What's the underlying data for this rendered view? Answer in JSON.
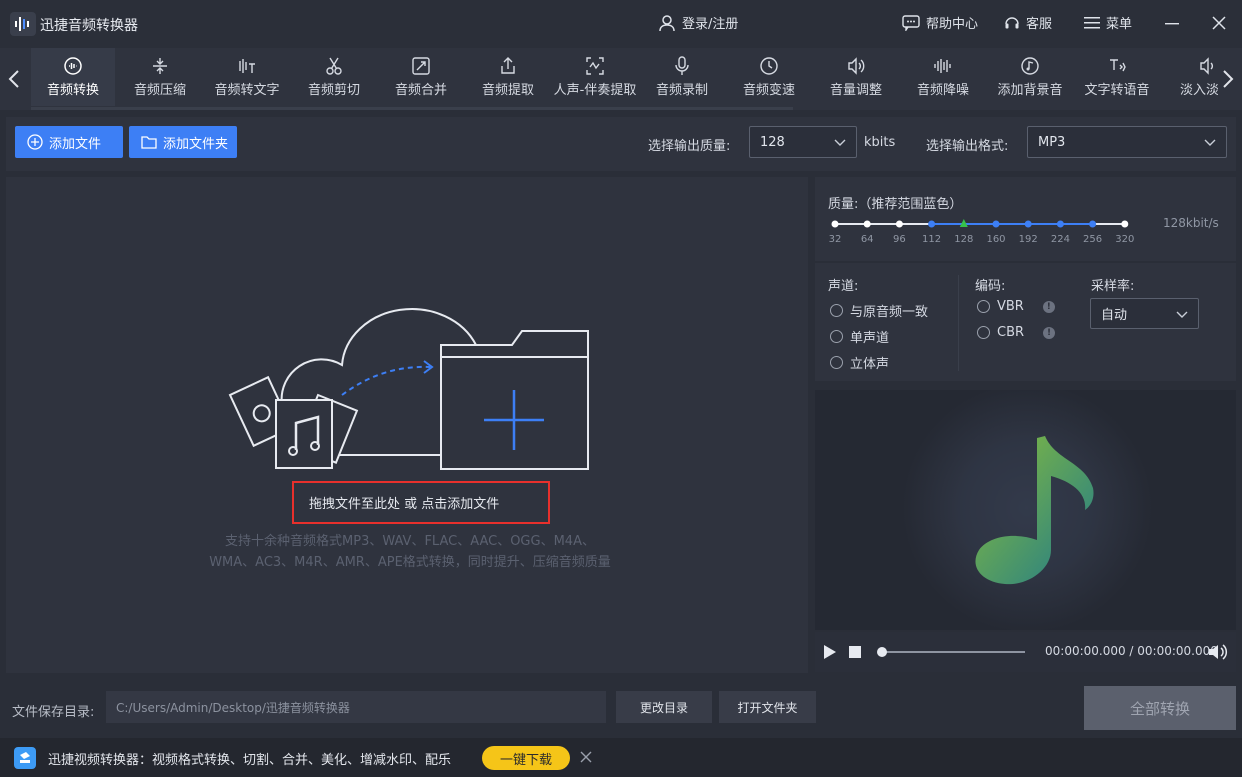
{
  "app": {
    "title": "迅捷音频转换器"
  },
  "header": {
    "login": "登录/注册",
    "help": "帮助中心",
    "service": "客服",
    "menu": "菜单"
  },
  "toolbar": {
    "tools": [
      {
        "label": "音频转换",
        "icon": "audio-convert-icon",
        "active": true
      },
      {
        "label": "音频压缩",
        "icon": "compress-icon"
      },
      {
        "label": "音频转文字",
        "icon": "audio-to-text-icon"
      },
      {
        "label": "音频剪切",
        "icon": "scissors-icon"
      },
      {
        "label": "音频合并",
        "icon": "merge-icon"
      },
      {
        "label": "音频提取",
        "icon": "extract-icon"
      },
      {
        "label": "人声-伴奏提取",
        "icon": "vocal-separate-icon"
      },
      {
        "label": "音频录制",
        "icon": "microphone-icon"
      },
      {
        "label": "音频变速",
        "icon": "speed-icon"
      },
      {
        "label": "音量调整",
        "icon": "volume-icon"
      },
      {
        "label": "音频降噪",
        "icon": "denoise-icon"
      },
      {
        "label": "添加背景音",
        "icon": "bg-music-icon"
      },
      {
        "label": "文字转语音",
        "icon": "text-to-speech-icon"
      },
      {
        "label": "淡入淡",
        "icon": "fade-icon"
      }
    ]
  },
  "options": {
    "add_file": "添加文件",
    "add_folder": "添加文件夹",
    "quality_label": "选择输出质量:",
    "quality_value": "128",
    "quality_unit": "kbits",
    "format_label": "选择输出格式:",
    "format_value": "MP3"
  },
  "dropzone": {
    "hint": "拖拽文件至此处 或 点击添加文件",
    "support_line1": "支持十余种音频格式MP3、WAV、FLAC、AAC、OGG、M4A、",
    "support_line2": "WMA、AC3、M4R、AMR、APE格式转换，同时提升、压缩音频质量"
  },
  "quality_panel": {
    "title": "质量:（推荐范围蓝色）",
    "ticks": [
      "32",
      "64",
      "96",
      "112",
      "128",
      "160",
      "192",
      "224",
      "256",
      "320"
    ],
    "current": "128kbit/s",
    "tick_colors": [
      "#ffffff",
      "#ffffff",
      "#ffffff",
      "#3d7ff5",
      "#35c24b",
      "#3d7ff5",
      "#3d7ff5",
      "#3d7ff5",
      "#3d7ff5",
      "#ffffff"
    ]
  },
  "channel_panel": {
    "channel_title": "声道:",
    "channels": [
      "与原音频一致",
      "单声道",
      "立体声"
    ],
    "encoding_title": "编码:",
    "encodings": [
      "VBR",
      "CBR"
    ],
    "sample_title": "采样率:",
    "sample_value": "自动"
  },
  "player": {
    "time": "00:00:00.000 / 00:00:00.000"
  },
  "bottom": {
    "save_label": "文件保存目录:",
    "save_path": "C:/Users/Admin/Desktop/迅捷音频转换器",
    "change_dir": "更改目录",
    "open_folder": "打开文件夹",
    "convert_all": "全部转换"
  },
  "promo": {
    "text": "迅捷视频转换器：视频格式转换、切割、合并、美化、增减水印、配乐",
    "download": "一键下载"
  }
}
